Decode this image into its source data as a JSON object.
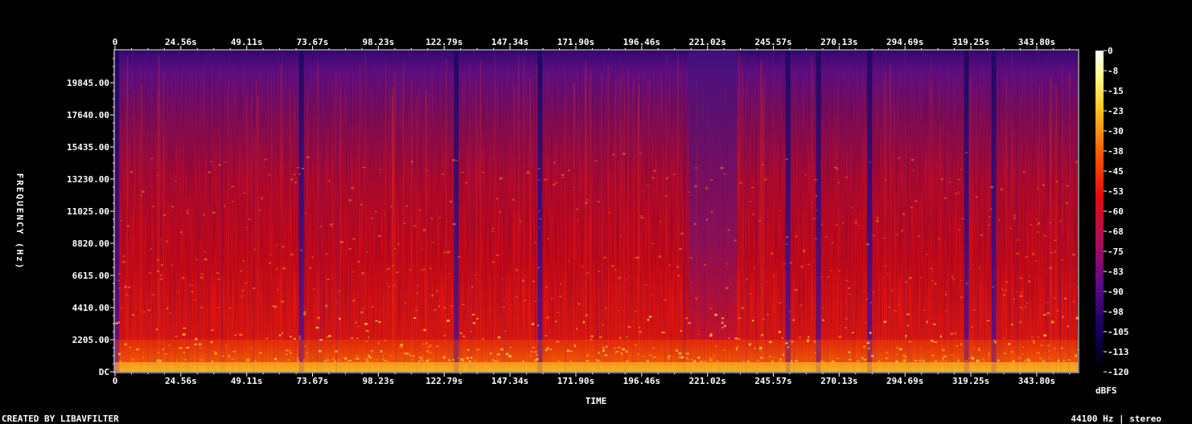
{
  "chart_data": {
    "type": "heatmap",
    "xlabel": "TIME",
    "ylabel": "FREQUENCY (Hz)",
    "x_ticks": [
      "0",
      "24.56s",
      "49.11s",
      "73.67s",
      "98.23s",
      "122.79s",
      "147.34s",
      "171.90s",
      "196.46s",
      "221.02s",
      "245.57s",
      "270.13s",
      "294.69s",
      "319.25s",
      "343.80s"
    ],
    "y_ticks": [
      "DC",
      "2205.00",
      "4410.00",
      "6615.00",
      "8820.00",
      "11025.00",
      "13230.00",
      "15435.00",
      "17640.00",
      "19845.00"
    ],
    "xlim": [
      0,
      365
    ],
    "ylim": [
      0,
      22050
    ],
    "colorbar": {
      "label": "dBFS",
      "ticks": [
        "0",
        "-8",
        "-15",
        "-23",
        "-30",
        "-38",
        "-45",
        "-53",
        "-60",
        "-68",
        "-75",
        "-83",
        "-90",
        "-98",
        "-105",
        "-113",
        "-120"
      ],
      "range": [
        -120,
        0
      ],
      "colors": [
        "#000000",
        "#12005a",
        "#5a0a8c",
        "#b40f50",
        "#e60a0a",
        "#ff5a00",
        "#ffc81e",
        "#ffff96",
        "#ffffff"
      ]
    },
    "quiet_gaps_s": [
      0.7,
      69.5,
      127.3,
      158.5,
      251.0,
      262.4,
      281.5,
      317.6,
      327.8
    ],
    "sparse_region_s": [
      214,
      232
    ],
    "footer_left": "CREATED BY LIBAVFILTER",
    "footer_right": "44100 Hz | stereo"
  }
}
